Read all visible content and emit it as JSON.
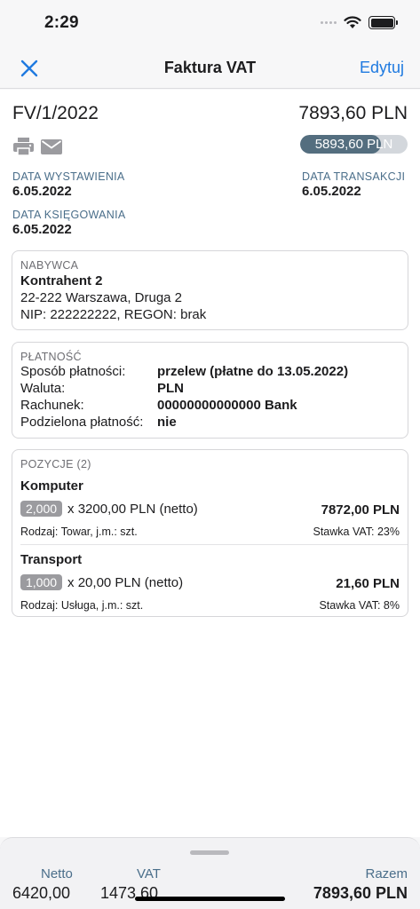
{
  "status": {
    "time": "2:29"
  },
  "nav": {
    "title": "Faktura VAT",
    "edit_label": "Edytuj"
  },
  "invoice": {
    "number": "FV/1/2022",
    "total": "7893,60 PLN",
    "paid_text": "5893,60 PLN",
    "paid_fraction": 0.75
  },
  "dates": {
    "issue_label": "DATA WYSTAWIENIA",
    "issue_value": "6.05.2022",
    "transaction_label": "DATA TRANSAKCJI",
    "transaction_value": "6.05.2022",
    "booking_label": "DATA KSIĘGOWANIA",
    "booking_value": "6.05.2022"
  },
  "buyer": {
    "title": "NABYWCA",
    "name": "Kontrahent 2",
    "address": "22-222 Warszawa, Druga 2",
    "ids": "NIP: 222222222, REGON: brak"
  },
  "payment": {
    "title": "PŁATNOŚĆ",
    "method_label": "Sposób płatności:",
    "method_value": "przelew (płatne do 13.05.2022)",
    "currency_label": "Waluta:",
    "currency_value": "PLN",
    "account_label": "Rachunek:",
    "account_value": "00000000000000 Bank",
    "split_label": "Podzielona płatność:",
    "split_value": "nie"
  },
  "positions": {
    "title": "POZYCJE (2)",
    "items": [
      {
        "name": "Komputer",
        "qty": "2,000",
        "price": "x 3200,00 PLN (netto)",
        "amount": "7872,00 PLN",
        "kind": "Rodzaj: Towar, j.m.: szt.",
        "vat": "Stawka VAT: 23%"
      },
      {
        "name": "Transport",
        "qty": "1,000",
        "price": "x 20,00 PLN (netto)",
        "amount": "21,60 PLN",
        "kind": "Rodzaj: Usługa, j.m.: szt.",
        "vat": "Stawka VAT: 8%"
      }
    ]
  },
  "summary": {
    "net_label": "Netto",
    "net_value": "6420,00",
    "vat_label": "VAT",
    "vat_value": "1473,60",
    "total_label": "Razem",
    "total_value": "7893,60 PLN"
  },
  "colors": {
    "accent": "#1f7ae0",
    "label": "#4a6e8a",
    "paid_fill": "#546e7f",
    "paid_track": "#d3d7dc"
  }
}
